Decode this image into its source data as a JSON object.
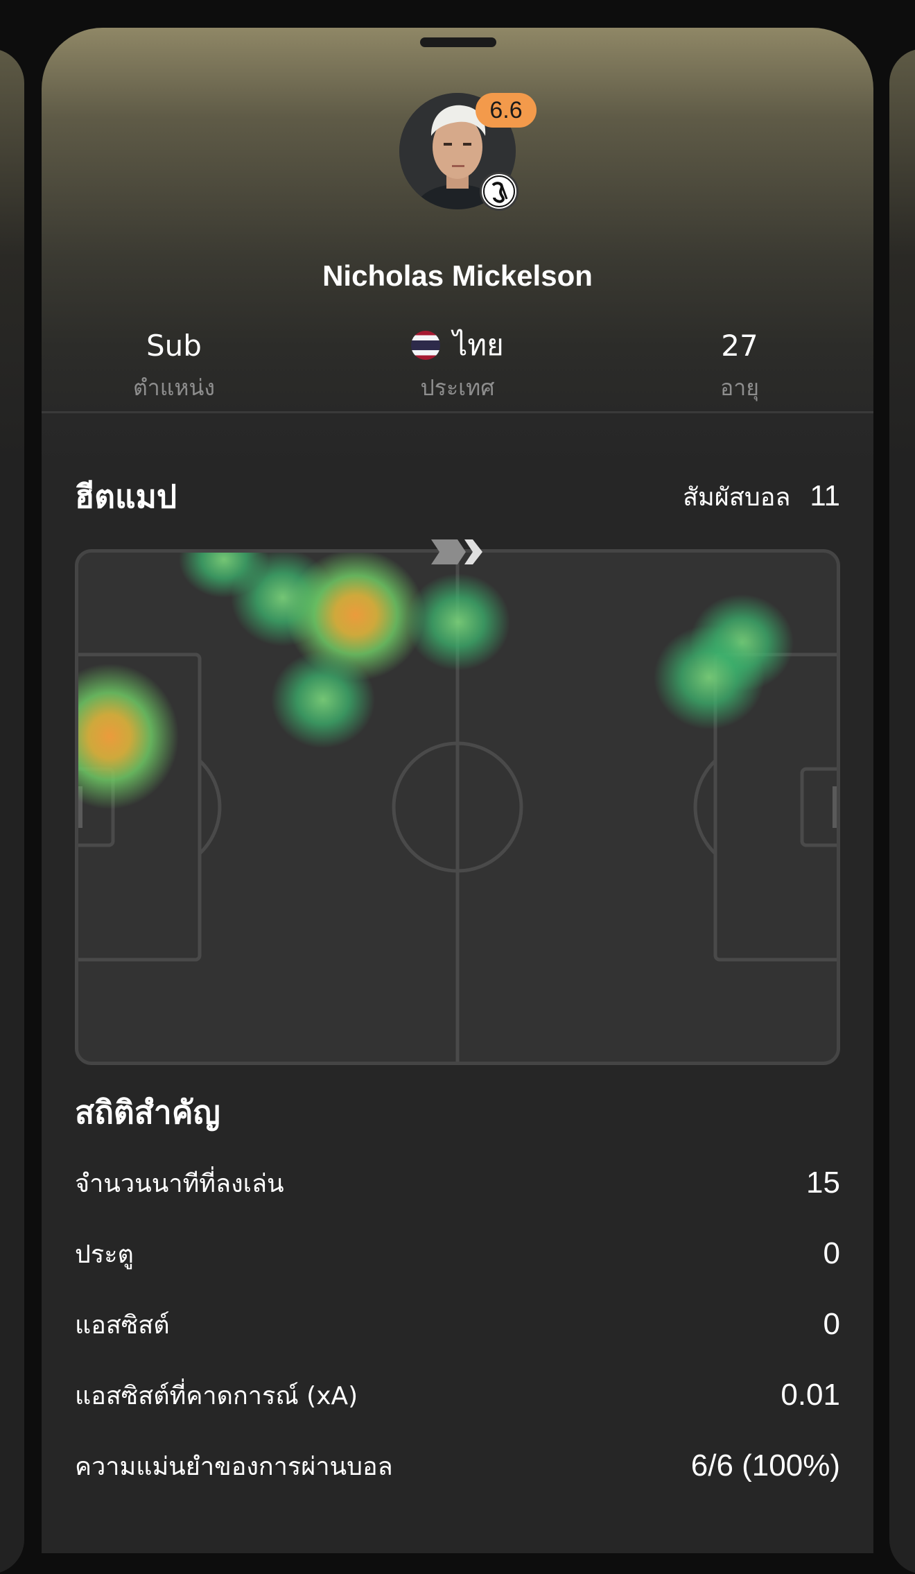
{
  "player": {
    "rating": "6.6",
    "name": "Nicholas Mickelson",
    "position_value": "Sub",
    "position_label": "ตำแหน่ง",
    "country_value": "ไทย",
    "country_label": "ประเทศ",
    "age_value": "27",
    "age_label": "อายุ"
  },
  "heatmap": {
    "title": "ฮีตแมป",
    "touches_label": "สัมผัสบอล",
    "touches_value": "11"
  },
  "stats": {
    "title": "สถิติสำคัญ",
    "rows": [
      {
        "label": "จำนวนนาทีที่ลงเล่น",
        "value": "15"
      },
      {
        "label": "ประตู",
        "value": "0"
      },
      {
        "label": "แอสซิสต์",
        "value": "0"
      },
      {
        "label": "แอสซิสต์ที่คาดการณ์ (xA)",
        "value": "0.01"
      },
      {
        "label": "ความแม่นยำของการผ่านบอล",
        "value": "6/6 (100%)"
      }
    ]
  },
  "colors": {
    "rating_badge": "#f39a4b",
    "heat_high": "#e8a048",
    "heat_low": "#3cb46e"
  },
  "icons": {
    "club_badge": "club-crest-icon",
    "country_flag": "thailand-flag-icon",
    "direction": "attack-direction-chevron-icon"
  }
}
